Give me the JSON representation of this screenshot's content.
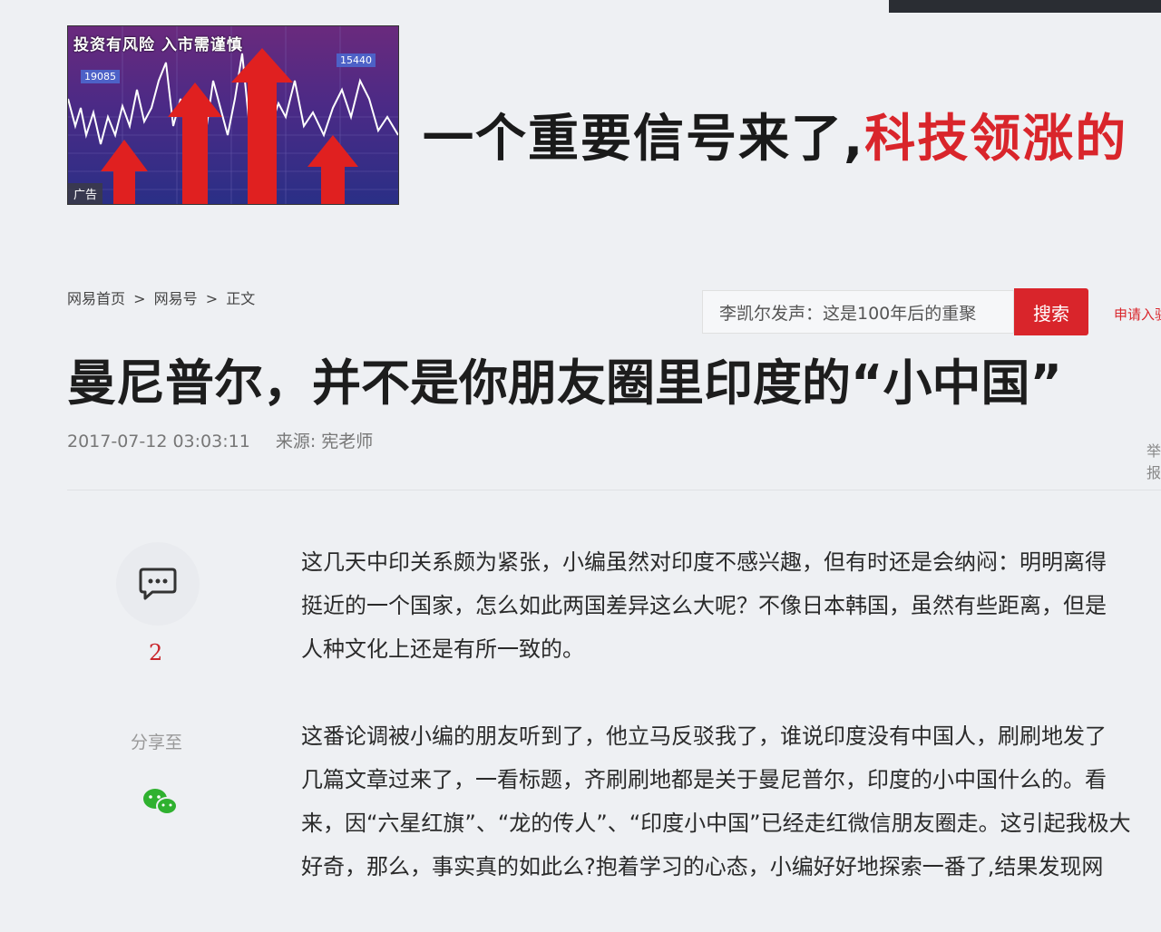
{
  "ad": {
    "warning": "投资有风险 入市需谨慎",
    "badge": "广告",
    "tag1": "19085",
    "tag2": "15440",
    "headline_black": "一个重要信号来了,",
    "headline_red": "科技领涨的"
  },
  "breadcrumb": {
    "home": "网易首页",
    "sep": ">",
    "section": "网易号",
    "current": "正文"
  },
  "search": {
    "value": "李凯尔发声：这是100年后的重聚",
    "button": "搜索"
  },
  "apply_link": "申请入驻",
  "article": {
    "title": "曼尼普尔，并不是你朋友圈里印度的“小中国”",
    "date": "2017-07-12 03:03:11",
    "source": "来源: 宪老师",
    "report": "举报",
    "paragraphs": [
      [
        "这几天中印关系颇为紧张，小编虽然对印度不感兴趣，但有时还是会纳闷：明明离得",
        "挺近的一个国家，怎么如此两国差异这么大呢？不像日本韩国，虽然有些距离，但是",
        "人种文化上还是有所一致的。"
      ],
      [
        "这番论调被小编的朋友听到了，他立马反驳我了，谁说印度没有中国人，刷刷地发了",
        "几篇文章过来了，一看标题，齐刷刷地都是关于曼尼普尔，印度的小中国什么的。看",
        "来，因“六星红旗”、“龙的传人”、“印度小中国”已经走红微信朋友圈走。这引起我极大",
        "好奇，那么，事实真的如此么?抱着学习的心态，小编好好地探索一番了,结果发现网"
      ]
    ]
  },
  "sidebar": {
    "comment_count": "2",
    "share_label": "分享至"
  },
  "colors": {
    "accent": "#d9252b",
    "text": "#222222"
  }
}
